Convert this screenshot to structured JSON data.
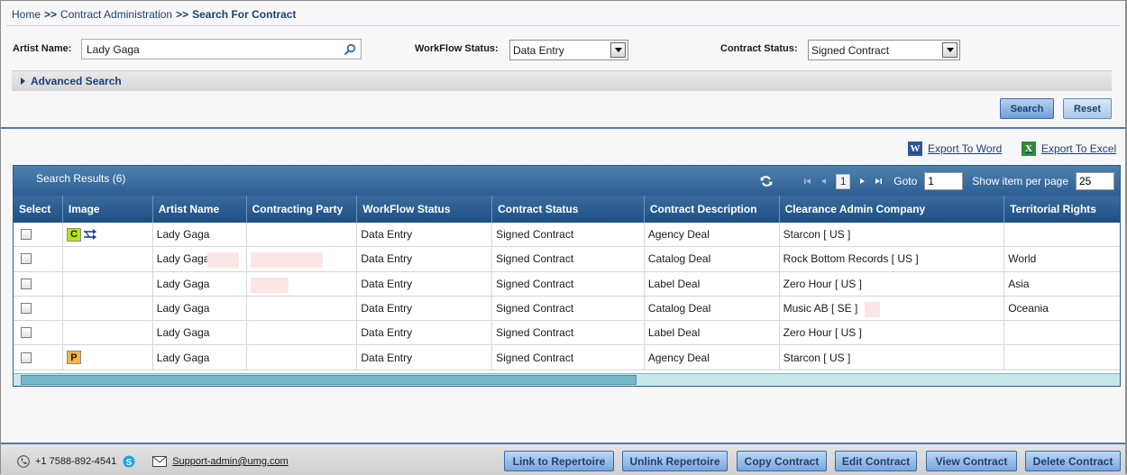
{
  "breadcrumb": {
    "home": "Home",
    "sep1": ">>",
    "section": "Contract Administration",
    "sep2": ">>",
    "current": "Search For Contract"
  },
  "filters": {
    "artist_label": "Artist Name:",
    "artist_value": "Lady Gaga",
    "workflow_label": "WorkFlow Status:",
    "workflow_value": "Data Entry",
    "contract_label": "Contract Status:",
    "contract_value": "Signed Contract"
  },
  "advanced_search": "Advanced Search",
  "buttons": {
    "search": "Search",
    "reset": "Reset"
  },
  "exports": {
    "word": "Export To Word",
    "excel": "Export To Excel"
  },
  "grid": {
    "title": "Search Results (6)",
    "pager": {
      "page": "1",
      "goto_label": "Goto",
      "goto_value": "1",
      "per_page_label": "Show item per page",
      "per_page_value": "25"
    },
    "columns": [
      "Select",
      "Image",
      "Artist Name",
      "Contracting Party",
      "WorkFlow Status",
      "Contract Status",
      "Contract Description",
      "Clearance Admin Company",
      "Territorial Rights"
    ],
    "rows": [
      {
        "badge": "C",
        "artist": "Lady Gaga",
        "party": "",
        "workflow": "Data Entry",
        "status": "Signed Contract",
        "description": "Agency Deal",
        "company": "Starcon [ US ]",
        "territory": ""
      },
      {
        "badge": "",
        "artist": "Lady Gaga",
        "party": "",
        "workflow": "Data Entry",
        "status": "Signed Contract",
        "description": "Catalog Deal",
        "company": "Rock Bottom Records [ US ]",
        "territory": "World"
      },
      {
        "badge": "",
        "artist": "Lady Gaga",
        "party": "",
        "workflow": "Data Entry",
        "status": "Signed Contract",
        "description": "Label Deal",
        "company": "Zero Hour [ US ]",
        "territory": "Asia"
      },
      {
        "badge": "",
        "artist": "Lady Gaga",
        "party": "",
        "workflow": "Data Entry",
        "status": "Signed Contract",
        "description": "Catalog Deal",
        "company": "Music AB [ SE ]",
        "territory": "Oceania"
      },
      {
        "badge": "",
        "artist": "Lady Gaga",
        "party": "",
        "workflow": "Data Entry",
        "status": "Signed Contract",
        "description": "Label Deal",
        "company": "Zero Hour [ US ]",
        "territory": ""
      },
      {
        "badge": "P",
        "artist": "Lady Gaga",
        "party": "",
        "workflow": "Data Entry",
        "status": "Signed Contract",
        "description": "Agency Deal",
        "company": "Starcon [ US ]",
        "territory": ""
      }
    ]
  },
  "footer": {
    "phone": "+1 7588-892-4541",
    "email": "Support-admin@umg.com",
    "actions": [
      "Link to Repertoire",
      "Unlink Repertoire",
      "Copy Contract",
      "Edit Contract",
      "View Contract",
      "Delete Contract"
    ]
  },
  "colors": {
    "accent": "#1f3f73",
    "header_blue": "#2d5f93",
    "badge_c": "#b6e316",
    "badge_p": "#f7b24a"
  },
  "icons": [
    "search-icon",
    "refresh-icon",
    "first-page-icon",
    "prev-page-icon",
    "next-page-icon",
    "last-page-icon",
    "word-icon",
    "excel-icon",
    "phone-icon",
    "skype-icon",
    "mail-icon",
    "link-arrows-icon"
  ]
}
